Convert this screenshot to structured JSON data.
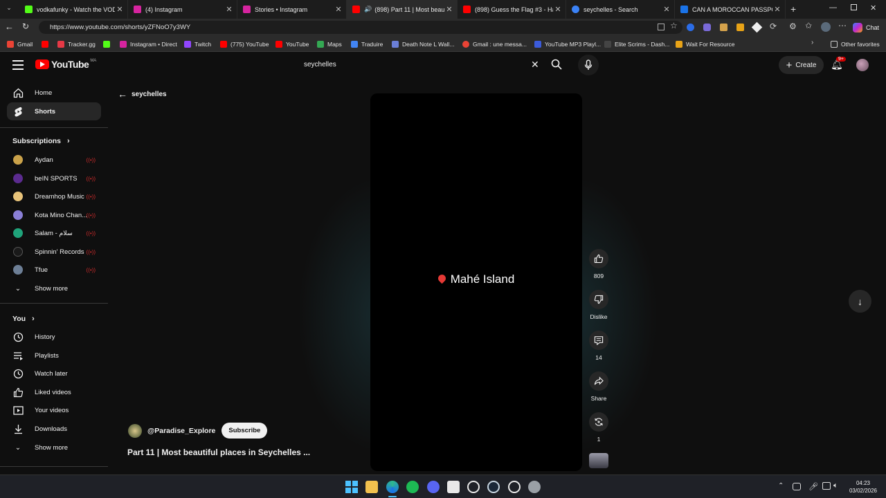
{
  "browser": {
    "tabs": [
      {
        "title": "vodkafunky - Watch the VOD on K",
        "icon_color": "#53fc18"
      },
      {
        "title": "(4) Instagram",
        "icon_color": "#d6249f"
      },
      {
        "title": "Stories • Instagram",
        "icon_color": "#d6249f"
      },
      {
        "title": "(898) Part 11 | Most beautiful",
        "icon_color": "#ff0000"
      },
      {
        "title": "(898) Guess the Flag #3 - Hard! - Y",
        "icon_color": "#ff0000"
      },
      {
        "title": "seychelles - Search",
        "icon_color": "#3b82f6"
      },
      {
        "title": "CAN A MOROCCAN PASSPORT GE",
        "icon_color": "#1a73e8"
      }
    ],
    "url": "https://www.youtube.com/shorts/yZFNoO7y3WY",
    "bookmarks": [
      {
        "label": "Gmail",
        "color": "#ea4335"
      },
      {
        "label": "",
        "color": "#ff0000"
      },
      {
        "label": "Tracker.gg",
        "color": "#e63946"
      },
      {
        "label": "",
        "color": "#53fc18"
      },
      {
        "label": "Instagram • Direct",
        "color": "#d6249f"
      },
      {
        "label": "Twitch",
        "color": "#9146ff"
      },
      {
        "label": "(775) YouTube",
        "color": "#ff0000"
      },
      {
        "label": "YouTube",
        "color": "#ff0000"
      },
      {
        "label": "Maps",
        "color": "#34a853"
      },
      {
        "label": "Traduire",
        "color": "#4285f4"
      },
      {
        "label": "Death Note L Wall...",
        "color": "#6b7fd7"
      },
      {
        "label": "Gmail : une messa...",
        "color": "#ea4335"
      },
      {
        "label": "YouTube MP3 Playl...",
        "color": "#3b5bdb"
      },
      {
        "label": "Elite Scrims - Dash...",
        "color": "#444444"
      },
      {
        "label": "Wait For Resource",
        "color": "#e8a317"
      }
    ],
    "other_favorites": "Other favorites",
    "chat_label": "Chat"
  },
  "youtube": {
    "logo_text": "YouTube",
    "country_code": "MA",
    "search_value": "seychelles",
    "create_label": "Create",
    "notification_badge": "9+",
    "back_label": "seychelles",
    "sidebar": {
      "home": "Home",
      "shorts": "Shorts",
      "subscriptions_header": "Subscriptions",
      "subscriptions": [
        {
          "name": "Aydan",
          "color": "#caa24a"
        },
        {
          "name": "beIN SPORTS",
          "color": "#5b2b8f"
        },
        {
          "name": "Dreamhop Music",
          "color": "#e8c37a"
        },
        {
          "name": "Kota Mino Chan...",
          "color": "#8a7fd6"
        },
        {
          "name": "Salam - سلام",
          "color": "#1fa37a"
        },
        {
          "name": "Spinnin' Records",
          "color": "#1a1a1a"
        },
        {
          "name": "Tfue",
          "color": "#6d7f96"
        }
      ],
      "show_more_1": "Show more",
      "you_header": "You",
      "you_items": [
        "History",
        "Playlists",
        "Watch later",
        "Liked videos",
        "Your videos",
        "Downloads"
      ],
      "show_more_2": "Show more"
    },
    "short": {
      "overlay_text": "Mahé Island",
      "channel": "@Paradise_Explore",
      "subscribe_label": "Subscribe",
      "title": "Part 11 | Most beautiful places in Seychelles ...",
      "like_count": "809",
      "dislike_label": "Dislike",
      "comment_count": "14",
      "share_label": "Share",
      "remix_count": "1"
    }
  },
  "taskbar": {
    "time": "04:23",
    "date": "03/02/2026",
    "apps": [
      {
        "name": "windows-start",
        "color": "#4cc2ff"
      },
      {
        "name": "file-explorer",
        "color": "#f2c14e"
      },
      {
        "name": "edge",
        "color": "#2fb98d"
      },
      {
        "name": "spotify",
        "color": "#1db954"
      },
      {
        "name": "discord",
        "color": "#5865f2"
      },
      {
        "name": "store",
        "color": "#e8e8e8"
      },
      {
        "name": "capture",
        "color": "#e8e8e8"
      },
      {
        "name": "steam",
        "color": "#c7d5e0"
      },
      {
        "name": "chrome",
        "color": "#e8e8e8"
      },
      {
        "name": "settings",
        "color": "#9aa0a6"
      }
    ]
  }
}
